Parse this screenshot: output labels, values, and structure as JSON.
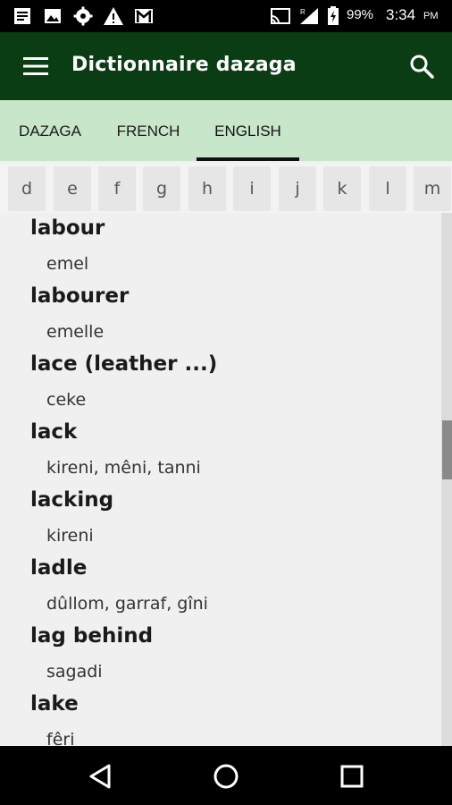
{
  "status_bar": {
    "battery_percent": "99%",
    "time": "3:34",
    "ampm": "PM",
    "icons": [
      "news-icon",
      "image-icon",
      "gear-icon",
      "warning-icon",
      "gmail-icon",
      "cast-icon",
      "signal-icon",
      "battery-charging-icon"
    ]
  },
  "app_bar": {
    "title": "Dictionnaire dazaga",
    "menu_icon": "hamburger-menu-icon",
    "search_icon": "search-icon",
    "color": "#0b3d14"
  },
  "tabs": [
    {
      "label": "DAZAGA",
      "active": false
    },
    {
      "label": "FRENCH",
      "active": false
    },
    {
      "label": "ENGLISH",
      "active": true
    }
  ],
  "tab_bar_color": "#c8e6c9",
  "letters": [
    "d",
    "e",
    "f",
    "g",
    "h",
    "i",
    "j",
    "k",
    "l",
    "m"
  ],
  "entries": [
    {
      "headword": "labour",
      "translation": "emel"
    },
    {
      "headword": "labourer",
      "translation": "emelle"
    },
    {
      "headword": "lace (leather ...)",
      "translation": "ceke"
    },
    {
      "headword": "lack",
      "translation": "kireni, mêni, tanni"
    },
    {
      "headword": "lacking",
      "translation": "kireni"
    },
    {
      "headword": "ladle",
      "translation": "dûllom, garraf, gîni"
    },
    {
      "headword": "lag behind",
      "translation": "sagadi"
    },
    {
      "headword": "lake",
      "translation": "fêri"
    }
  ],
  "nav_bar": {
    "icons": [
      "back-icon",
      "home-icon",
      "recents-icon"
    ]
  }
}
